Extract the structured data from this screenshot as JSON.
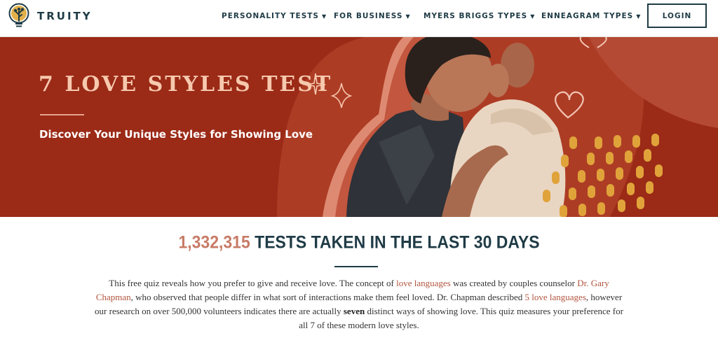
{
  "brand": {
    "name": "TRUITY",
    "logo_icon": "lightbulb-tree-icon"
  },
  "nav": {
    "items": [
      {
        "label": "PERSONALITY TESTS",
        "icon": "caret-down-icon"
      },
      {
        "label": "FOR BUSINESS",
        "icon": "caret-down-icon"
      },
      {
        "label": "MYERS BRIGGS TYPES",
        "icon": "caret-down-icon"
      },
      {
        "label": "ENNEAGRAM TYPES",
        "icon": "caret-down-icon"
      }
    ],
    "login_label": "LOGIN"
  },
  "hero": {
    "title": "7 LOVE STYLES TEST",
    "subtitle": "Discover Your Unique Styles for Showing Love",
    "decorations": [
      "sparkle-icon",
      "heart-icon"
    ]
  },
  "stats": {
    "count": "1,332,315",
    "label": " TESTS TAKEN IN THE LAST 30 DAYS"
  },
  "intro": {
    "t1": "This free quiz reveals how you prefer to give and receive love. The concept of ",
    "link1": "love languages",
    "t2": " was created by couples counselor ",
    "link2": "Dr. Gary Chapman",
    "t3": ", who observed that people differ in what sort of interactions make them feel loved. Dr. Chapman described ",
    "link3": "5 love languages",
    "t4": ", however our research on over 500,000 volunteers indicates there are actually ",
    "bold1": "seven",
    "t5": " distinct ways of showing love. This quiz measures your preference for all 7 of these modern love styles."
  },
  "colors": {
    "hero_bg": "#9b2a17",
    "hero_title": "#f6c9ae",
    "accent_count": "#c87b67",
    "link": "#b1543e",
    "navy": "#1f3b46"
  }
}
